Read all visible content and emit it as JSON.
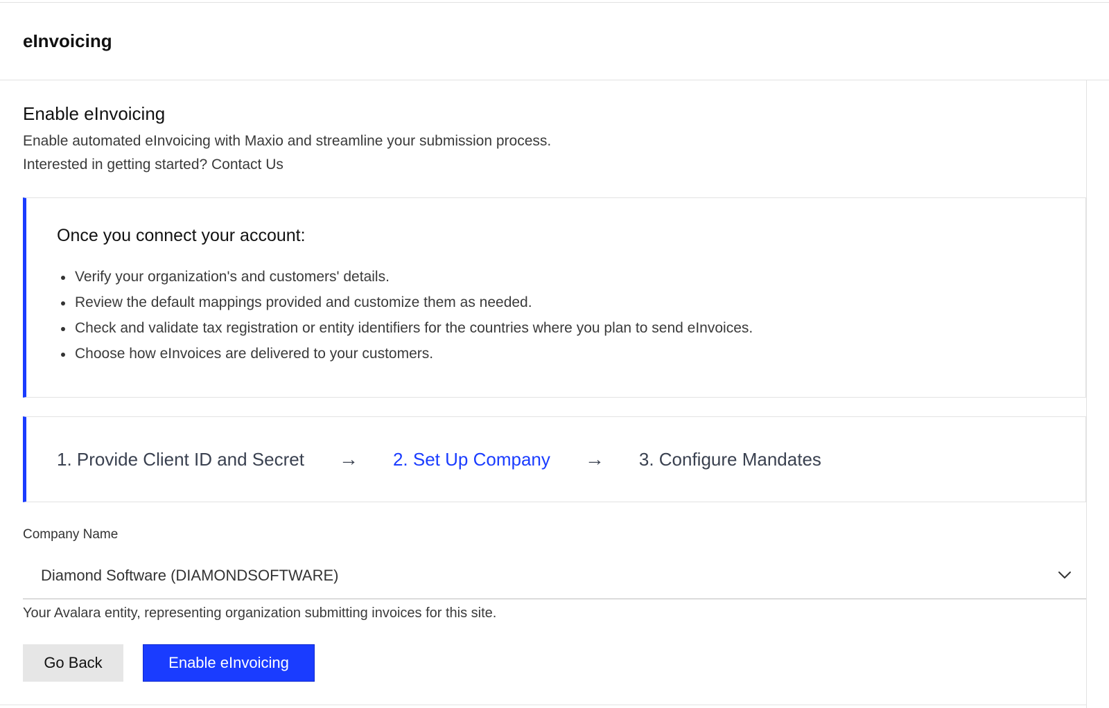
{
  "header": {
    "title": "eInvoicing"
  },
  "section": {
    "title": "Enable eInvoicing",
    "description": "Enable automated eInvoicing with Maxio and streamline your submission process.",
    "contact_prefix": "Interested in getting started? ",
    "contact_link": "Contact Us"
  },
  "info": {
    "title": "Once you connect your account:",
    "items": [
      "Verify your organization's and customers' details.",
      "Review the default mappings provided and customize them as needed.",
      "Check and validate tax registration or entity identifiers for the countries where you plan to send eInvoices.",
      "Choose how eInvoices are delivered to your customers."
    ]
  },
  "steps": [
    {
      "label": "1. Provide Client ID and Secret",
      "active": false
    },
    {
      "label": "2. Set Up Company",
      "active": true
    },
    {
      "label": "3. Configure Mandates",
      "active": false
    }
  ],
  "arrow_glyph": "→",
  "company": {
    "label": "Company Name",
    "value": "Diamond Software (DIAMONDSOFTWARE)",
    "helper": "Your Avalara entity, representing organization submitting invoices for this site."
  },
  "buttons": {
    "back": "Go Back",
    "enable": "Enable eInvoicing"
  },
  "colors": {
    "accent": "#1a3cff",
    "border": "#e2e2e2"
  }
}
